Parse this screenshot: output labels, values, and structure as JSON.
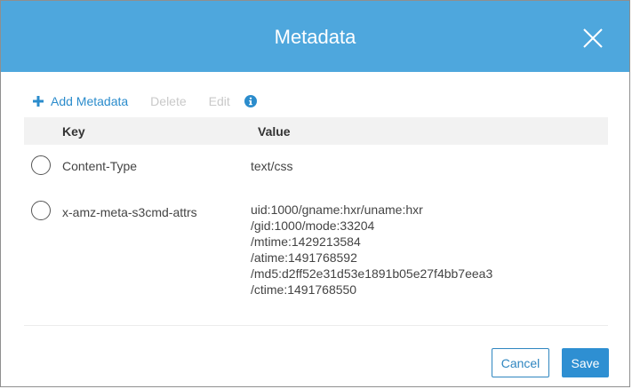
{
  "dialog": {
    "title": "Metadata"
  },
  "toolbar": {
    "add_label": "Add Metadata",
    "delete_label": "Delete",
    "edit_label": "Edit"
  },
  "table": {
    "headers": {
      "key": "Key",
      "value": "Value"
    },
    "rows": [
      {
        "key": "Content-Type",
        "value_lines": [
          "text/css"
        ],
        "selected": false
      },
      {
        "key": "x-amz-meta-s3cmd-attrs",
        "value_lines": [
          "uid:1000/gname:hxr/uname:hxr",
          "/gid:1000/mode:33204",
          "/mtime:1429213584",
          "/atime:1491768592",
          "/md5:d2ff52e31d53e1891b05e27f4bb7eea3",
          "/ctime:1491768550"
        ],
        "selected": false
      }
    ]
  },
  "footer": {
    "cancel_label": "Cancel",
    "save_label": "Save"
  },
  "colors": {
    "header_bg": "#4ea7dd",
    "accent": "#2e8fd2",
    "disabled_text": "#c9c9c9"
  },
  "icons": {
    "close": "close-icon",
    "add": "plus-icon",
    "info": "info-icon"
  }
}
